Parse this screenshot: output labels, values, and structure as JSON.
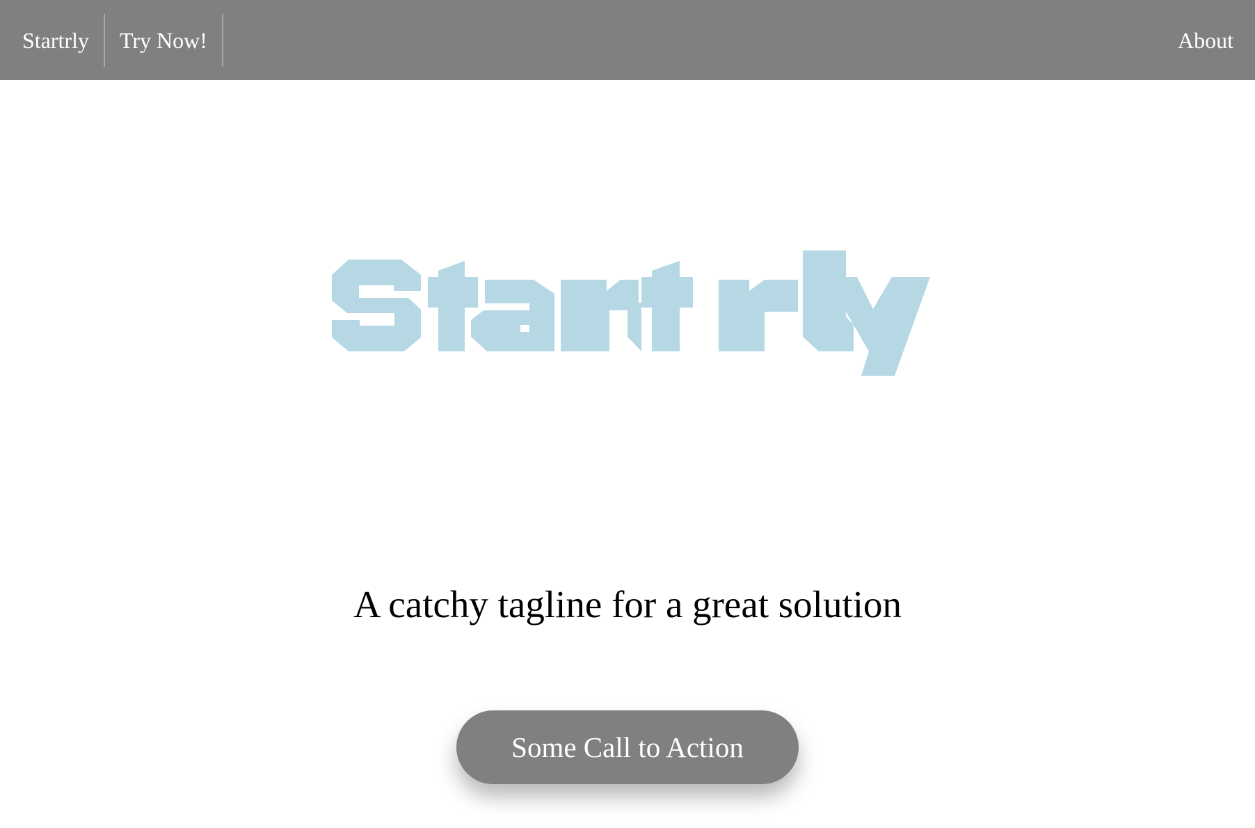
{
  "nav": {
    "brand_label": "Startrly",
    "try_label": "Try Now!",
    "about_label": "About"
  },
  "hero": {
    "logo_text": "Startrly",
    "tagline": "A catchy tagline for a great solution",
    "cta_label": "Some Call to Action"
  },
  "colors": {
    "topbar": "#808080",
    "logo": "#b6d8e4",
    "cta_background": "#808080",
    "text_light": "#ffffff",
    "text_dark": "#000000"
  }
}
